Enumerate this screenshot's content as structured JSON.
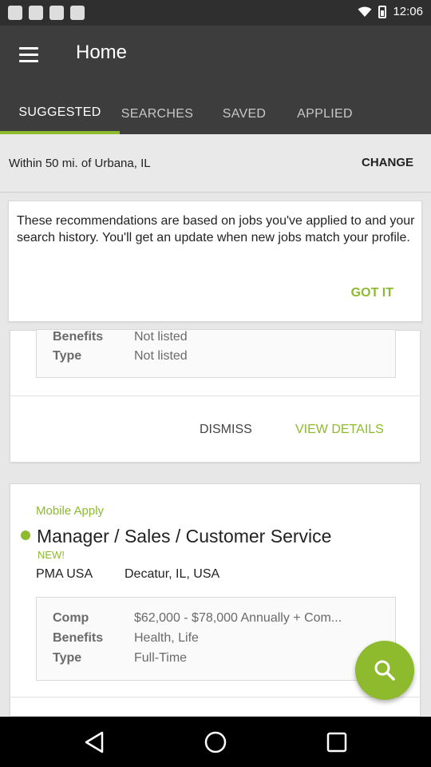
{
  "status_bar": {
    "time": "12:06",
    "icons": [
      "notification-icon",
      "notification-icon",
      "notification-icon",
      "notification-icon",
      "wifi-icon",
      "battery-icon"
    ]
  },
  "header": {
    "title": "Home",
    "menu_icon": "hamburger-menu-icon"
  },
  "tabs": [
    {
      "label": "SUGGESTED",
      "active": true
    },
    {
      "label": "SEARCHES",
      "active": false
    },
    {
      "label": "SAVED",
      "active": false
    },
    {
      "label": "APPLIED",
      "active": false
    }
  ],
  "location": {
    "text": "Within 50 mi. of Urbana, IL",
    "change_label": "CHANGE"
  },
  "tip_card": {
    "text": "These recommendations are based on jobs you've applied to and your search history. You'll get an update when new jobs match your profile.",
    "button_label": "GOT IT"
  },
  "job_cards": [
    {
      "details": [
        {
          "label": "Benefits",
          "value": "Not listed"
        },
        {
          "label": "Type",
          "value": "Not listed"
        }
      ],
      "dismiss_label": "DISMISS",
      "view_details_label": "VIEW DETAILS"
    },
    {
      "apply_type": "Mobile Apply",
      "title": "Manager / Sales / Customer Service",
      "badge": "NEW!",
      "company": "PMA USA",
      "location": "Decatur, IL, USA",
      "details": [
        {
          "label": "Comp",
          "value": "$62,000 - $78,000 Annually + Com..."
        },
        {
          "label": "Benefits",
          "value": "Health, Life"
        },
        {
          "label": "Type",
          "value": "Full-Time"
        }
      ]
    }
  ],
  "fab": {
    "icon": "search-icon"
  },
  "nav": {
    "icons": [
      "back-icon",
      "home-icon",
      "recent-apps-icon"
    ]
  },
  "colors": {
    "accent": "#8dbb2d",
    "app_bar": "#3d3d3d",
    "status_bar": "#2f2f2f",
    "background": "#e7e7e7"
  }
}
